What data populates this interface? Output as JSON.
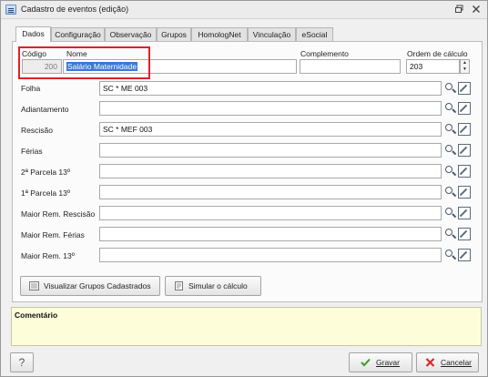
{
  "window": {
    "title": "Cadastro de eventos (edição)",
    "restore_icon": "restore-icon",
    "close_icon": "close-icon"
  },
  "tabs": [
    {
      "label": "Dados",
      "active": true
    },
    {
      "label": "Configuração",
      "active": false
    },
    {
      "label": "Observação",
      "active": false
    },
    {
      "label": "Grupos",
      "active": false
    },
    {
      "label": "HomologNet",
      "active": false
    },
    {
      "label": "Vinculação",
      "active": false
    },
    {
      "label": "eSocial",
      "active": false
    }
  ],
  "form": {
    "codigo_label": "Código",
    "codigo_value": "200",
    "nome_label": "Nome",
    "nome_value": "Salário Maternidade",
    "complemento_label": "Complemento",
    "complemento_value": "",
    "ordem_label": "Ordem de cálculo",
    "ordem_value": "203",
    "rows": [
      {
        "label": "Folha",
        "value": "SC * ME 003"
      },
      {
        "label": "Adiantamento",
        "value": ""
      },
      {
        "label": "Rescisão",
        "value": "SC * MEF 003"
      },
      {
        "label": "Férias",
        "value": ""
      },
      {
        "label": "2ª Parcela 13º",
        "value": ""
      },
      {
        "label": "1ª Parcela 13º",
        "value": ""
      },
      {
        "label": "Maior Rem. Rescisão",
        "value": ""
      },
      {
        "label": "Maior Rem. Férias",
        "value": ""
      },
      {
        "label": "Maior Rem. 13º",
        "value": ""
      }
    ]
  },
  "buttons": {
    "visualizar": "Visualizar Grupos Cadastrados",
    "simular": "Simular o cálculo",
    "help": "?",
    "gravar": "Gravar",
    "cancelar": "Cancelar"
  },
  "comment": {
    "label": "Comentário",
    "value": ""
  },
  "colors": {
    "highlight": "#e0202c",
    "selection": "#3a78d8",
    "comment_bg": "#fdfdd9",
    "gravar_check": "#3c9a2c",
    "cancelar_x": "#d22d2d"
  }
}
